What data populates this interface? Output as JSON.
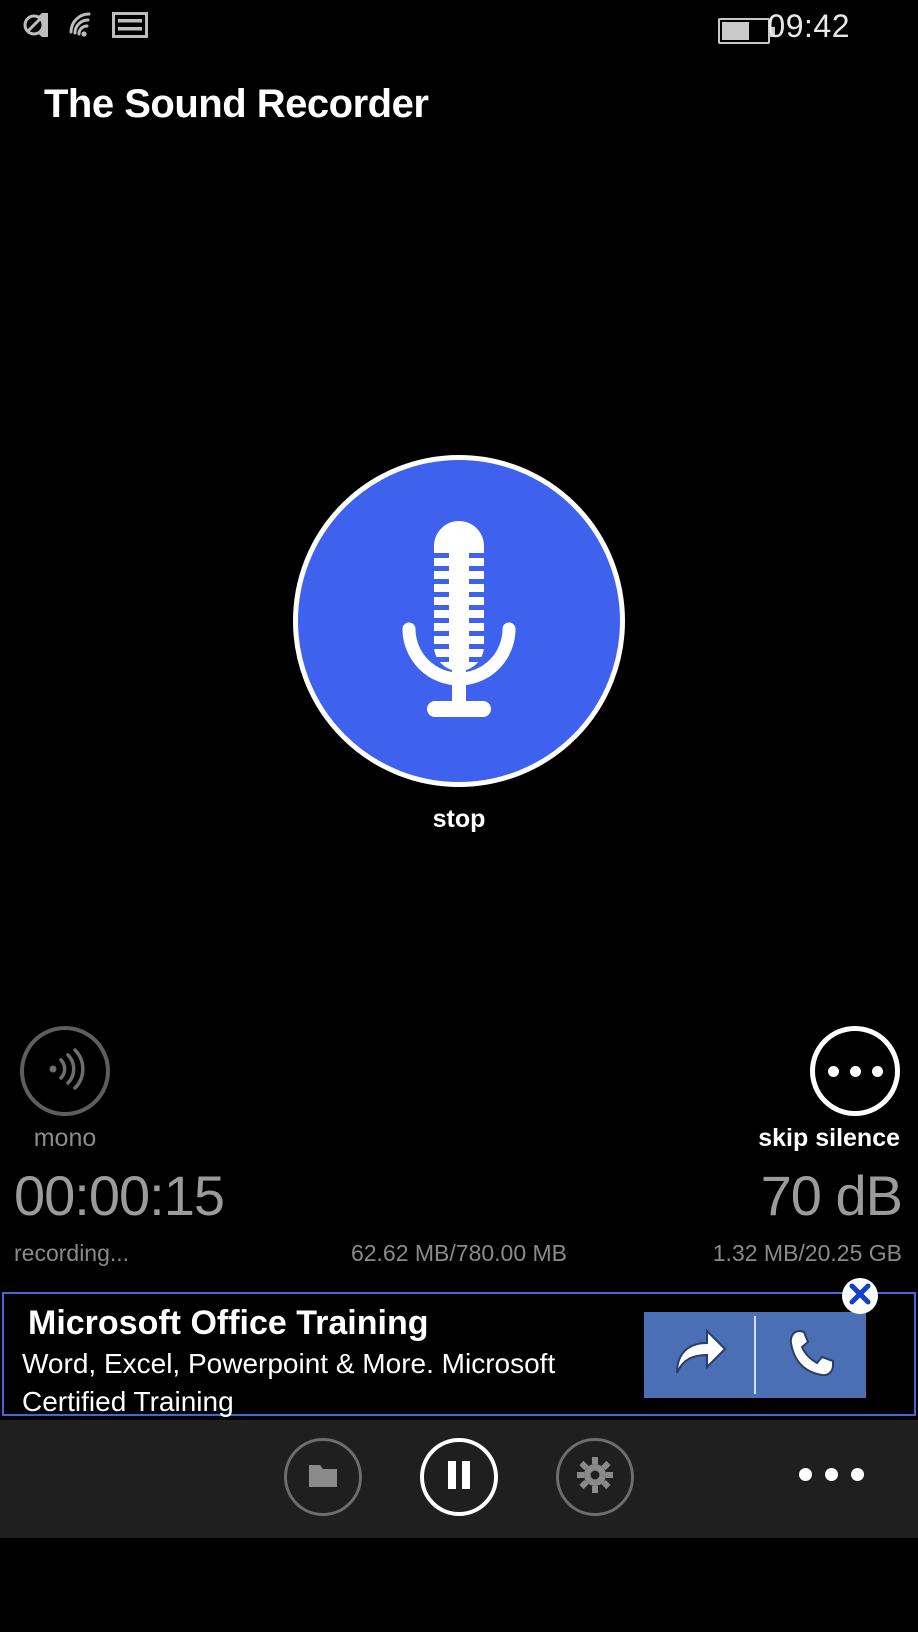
{
  "statusbar": {
    "icons": [
      "ringer-off-icon",
      "wifi-icon",
      "sim-card-icon"
    ],
    "battery_percent": "57",
    "time": "09:42"
  },
  "app": {
    "title": "The Sound Recorder"
  },
  "record": {
    "icon": "microphone-icon",
    "label": "stop",
    "accent_color": "#3f62ee",
    "ring_color": "#ffffff"
  },
  "mono": {
    "icon": "sound-waves-icon",
    "label": "mono"
  },
  "skip_silence": {
    "icon": "ellipsis-icon",
    "label": "skip silence"
  },
  "counters": {
    "timer": "00:00:15",
    "level": "70 dB",
    "status": "recording...",
    "file_size": "62.62 MB/780.00 MB",
    "storage": "1.32 MB/20.25 GB"
  },
  "ad": {
    "title": "Microsoft Office Training",
    "body": "Word, Excel, Powerpoint & More. Microsoft Certified Training",
    "actions": [
      {
        "icon": "arrow-forward-icon"
      },
      {
        "icon": "phone-icon"
      }
    ],
    "close_icon": "close-x-icon",
    "border_color": "#4169d6",
    "button_color": "#4a6fb5"
  },
  "appbar": {
    "buttons": [
      {
        "icon": "folder-icon",
        "name": "recordings-button"
      },
      {
        "icon": "pause-icon",
        "name": "pause-button"
      },
      {
        "icon": "gear-icon",
        "name": "settings-button"
      }
    ],
    "more_icon": "ellipsis-icon"
  }
}
